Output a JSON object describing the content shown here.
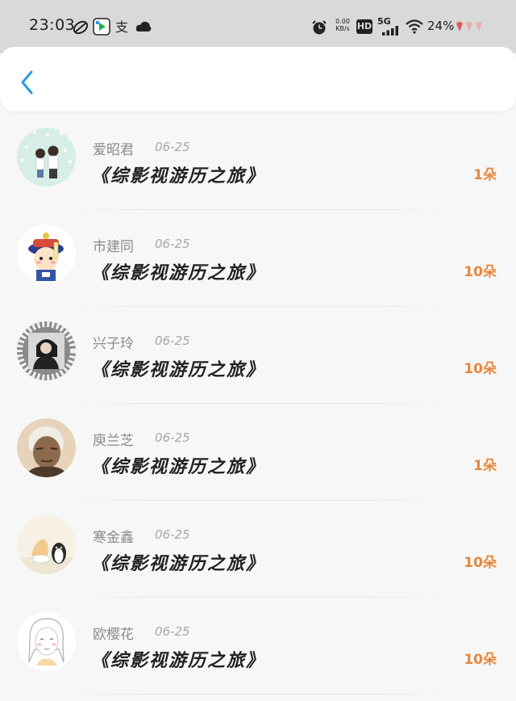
{
  "status_bar": {
    "time": "23:03",
    "net_speed_value": "0.00",
    "net_speed_unit": "KB/s",
    "hd_label": "HD",
    "signal_label": "5G",
    "battery": "24%"
  },
  "records": [
    {
      "name": "爱昭君",
      "date": "06-25",
      "title": "《综影视游历之旅》",
      "amount": "1朵",
      "avatar": "couple-illustration-avatar"
    },
    {
      "name": "市建同",
      "date": "06-25",
      "title": "《综影视游历之旅》",
      "amount": "10朵",
      "avatar": "qing-official-cartoon-avatar"
    },
    {
      "name": "兴子玲",
      "date": "06-25",
      "title": "《综影视游历之旅》",
      "amount": "10朵",
      "avatar": "girl-photo-avatar"
    },
    {
      "name": "庾兰芝",
      "date": "06-25",
      "title": "《综影视游历之旅》",
      "amount": "1朵",
      "avatar": "elderly-man-sepia-avatar"
    },
    {
      "name": "寒金鑫",
      "date": "06-25",
      "title": "《综影视游历之旅》",
      "amount": "10朵",
      "avatar": "penguin-illustration-avatar"
    },
    {
      "name": "欧樱花",
      "date": "06-25",
      "title": "《综影视游历之旅》",
      "amount": "10朵",
      "avatar": "girl-sketch-avatar"
    }
  ],
  "colors": {
    "accent_blue": "#2e9ae6",
    "amount_orange": "#e8873b"
  }
}
